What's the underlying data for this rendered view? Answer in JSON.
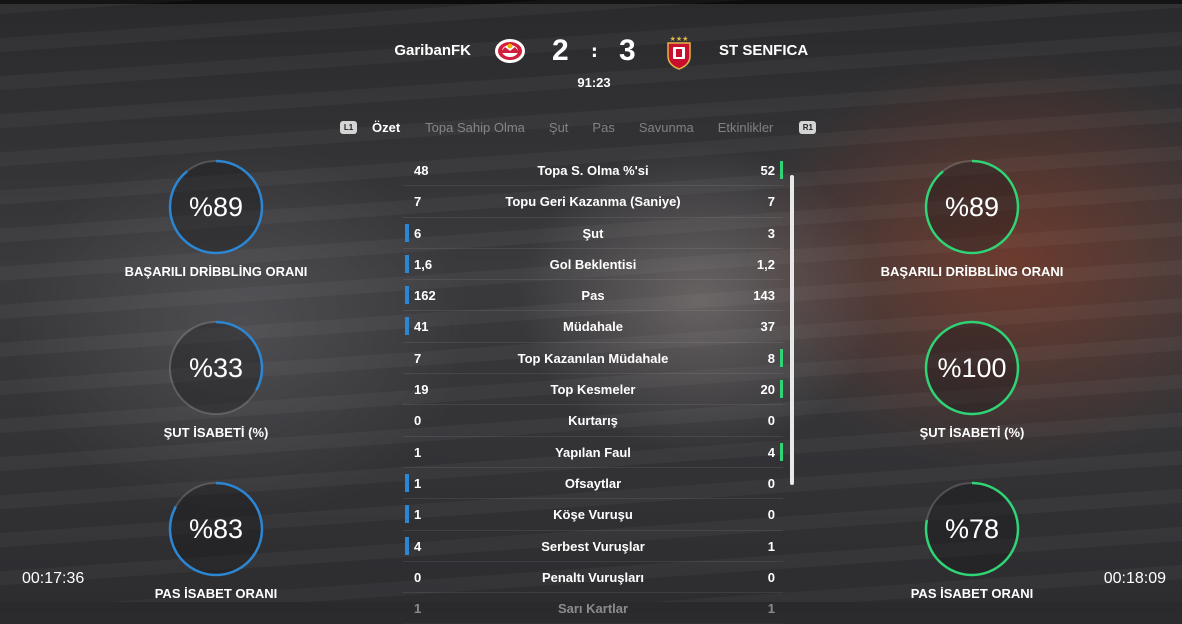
{
  "header": {
    "home_team": "GaribanFK",
    "away_team": "ST SENFICA",
    "home_score": "2",
    "away_score": "3",
    "separator": ":",
    "match_clock": "91:23"
  },
  "tabs": {
    "left_button": "L1",
    "right_button": "R1",
    "items": [
      "Özet",
      "Topa Sahip Olma",
      "Şut",
      "Pas",
      "Savunma",
      "Etkinlikler"
    ],
    "active": "Özet"
  },
  "home_stats": [
    {
      "value": "%89",
      "label": "BAŞARILI DRİBBLİNG ORANI",
      "percent": 89
    },
    {
      "value": "%33",
      "label": "ŞUT İSABETİ (%)",
      "percent": 33
    },
    {
      "value": "%83",
      "label": "PAS İSABET ORANI",
      "percent": 83
    }
  ],
  "away_stats": [
    {
      "value": "%89",
      "label": "BAŞARILI DRİBBLİNG ORANI",
      "percent": 89
    },
    {
      "value": "%100",
      "label": "ŞUT İSABETİ (%)",
      "percent": 100
    },
    {
      "value": "%78",
      "label": "PAS İSABET ORANI",
      "percent": 78
    }
  ],
  "colors": {
    "home_accent": "#2b86d4",
    "away_accent": "#2fd474"
  },
  "stats_table": [
    {
      "name": "Topa S. Olma %'si",
      "home": "48",
      "away": "52",
      "leader": "away"
    },
    {
      "name": "Topu Geri Kazanma (Saniye)",
      "home": "7",
      "away": "7",
      "leader": "none"
    },
    {
      "name": "Şut",
      "home": "6",
      "away": "3",
      "leader": "home"
    },
    {
      "name": "Gol Beklentisi",
      "home": "1,6",
      "away": "1,2",
      "leader": "home"
    },
    {
      "name": "Pas",
      "home": "162",
      "away": "143",
      "leader": "home"
    },
    {
      "name": "Müdahale",
      "home": "41",
      "away": "37",
      "leader": "home"
    },
    {
      "name": "Top Kazanılan Müdahale",
      "home": "7",
      "away": "8",
      "leader": "away"
    },
    {
      "name": "Top Kesmeler",
      "home": "19",
      "away": "20",
      "leader": "away"
    },
    {
      "name": "Kurtarış",
      "home": "0",
      "away": "0",
      "leader": "none"
    },
    {
      "name": "Yapılan Faul",
      "home": "1",
      "away": "4",
      "leader": "away"
    },
    {
      "name": "Ofsaytlar",
      "home": "1",
      "away": "0",
      "leader": "home"
    },
    {
      "name": "Köşe Vuruşu",
      "home": "1",
      "away": "0",
      "leader": "home"
    },
    {
      "name": "Serbest Vuruşlar",
      "home": "4",
      "away": "1",
      "leader": "home"
    },
    {
      "name": "Penaltı Vuruşları",
      "home": "0",
      "away": "0",
      "leader": "none"
    },
    {
      "name": "Sarı Kartlar",
      "home": "1",
      "away": "1",
      "leader": "none"
    }
  ],
  "timers": {
    "left": "00:17:36",
    "right": "00:18:09"
  }
}
